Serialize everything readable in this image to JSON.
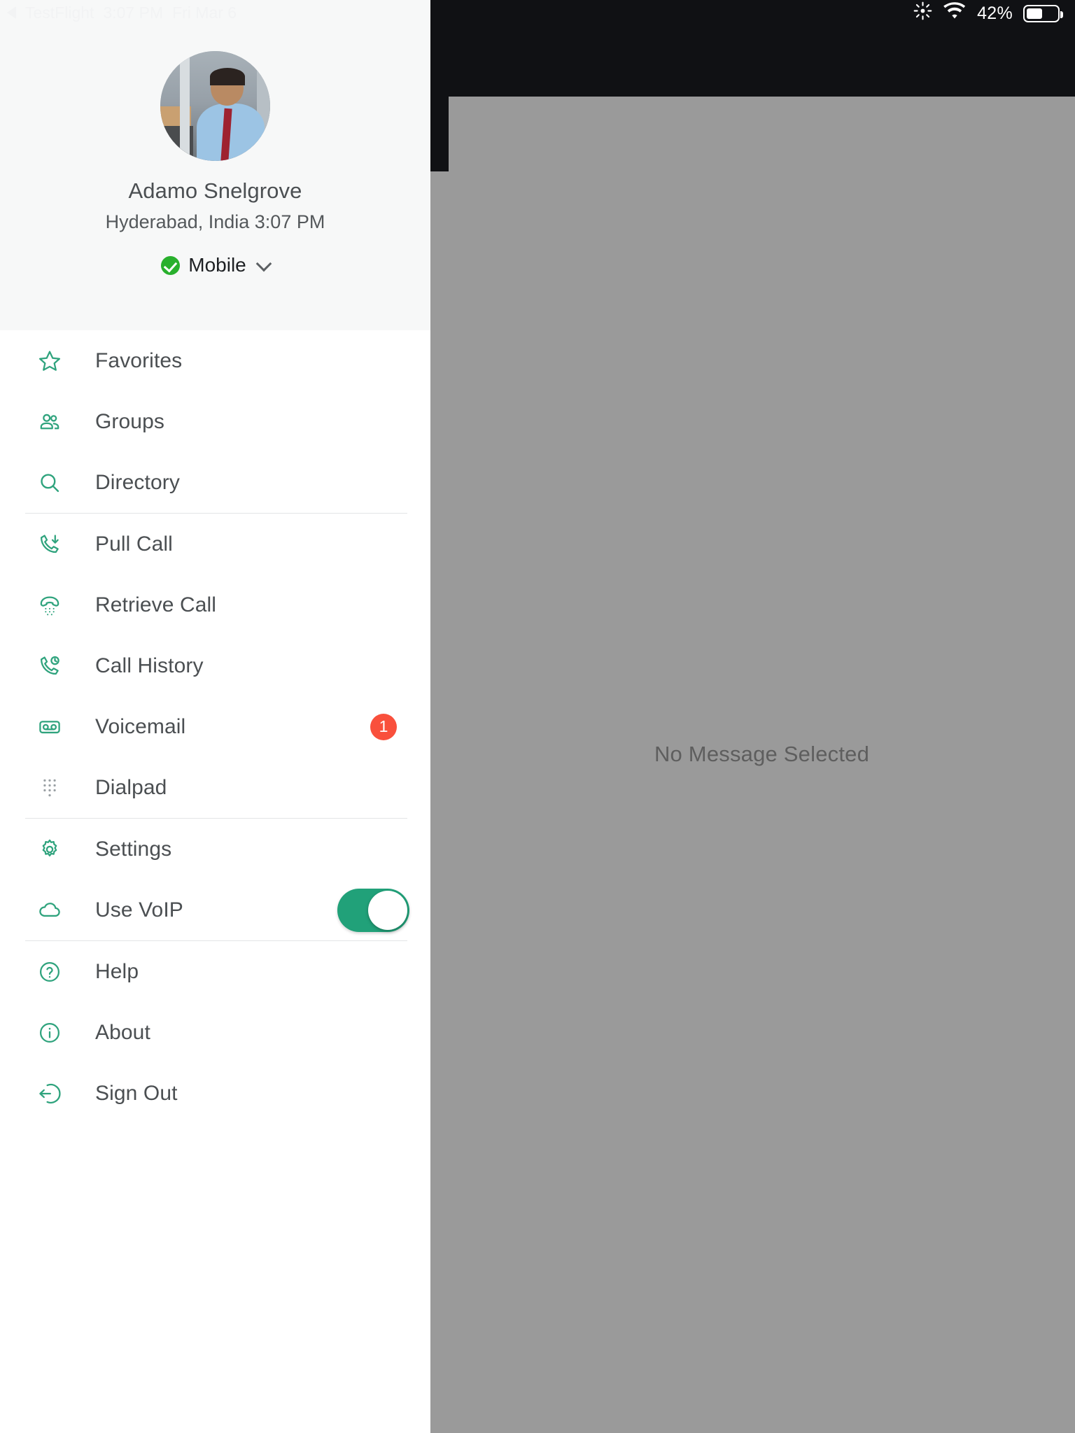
{
  "statusbar": {
    "back_app": "TestFlight",
    "time": "3:07 PM",
    "date": "Fri Mar 6",
    "brightness_icon": "brightness-icon",
    "wifi_icon": "wifi-icon",
    "battery_percent": "42%",
    "battery_icon": "battery-icon"
  },
  "profile": {
    "avatar_icon": "avatar-photo",
    "name": "Adamo Snelgrove",
    "location_time": "Hyderabad, India 3:07 PM",
    "presence_status": "Mobile",
    "presence_icon": "check-circle-icon",
    "chevron_icon": "chevron-down-icon"
  },
  "menu": {
    "items": [
      {
        "id": "favorites",
        "label": "Favorites",
        "icon": "star-icon"
      },
      {
        "id": "groups",
        "label": "Groups",
        "icon": "people-icon"
      },
      {
        "id": "directory",
        "label": "Directory",
        "icon": "search-icon"
      },
      {
        "id": "pull-call",
        "label": "Pull Call",
        "icon": "phone-down-arrow-icon"
      },
      {
        "id": "retrieve-call",
        "label": "Retrieve Call",
        "icon": "ringing-handset-icon"
      },
      {
        "id": "call-history",
        "label": "Call History",
        "icon": "phone-clock-icon"
      },
      {
        "id": "voicemail",
        "label": "Voicemail",
        "icon": "voicemail-icon",
        "badge": "1"
      },
      {
        "id": "dialpad",
        "label": "Dialpad",
        "icon": "dialpad-icon"
      },
      {
        "id": "settings",
        "label": "Settings",
        "icon": "gear-icon"
      },
      {
        "id": "use-voip",
        "label": "Use VoIP",
        "icon": "cloud-icon",
        "toggle": "on"
      },
      {
        "id": "help",
        "label": "Help",
        "icon": "question-circle-icon"
      },
      {
        "id": "about",
        "label": "About",
        "icon": "info-circle-icon"
      },
      {
        "id": "sign-out",
        "label": "Sign Out",
        "icon": "sign-out-icon"
      }
    ]
  },
  "detail": {
    "empty_state": "No Message Selected"
  },
  "colors": {
    "accent_green": "#2fa37d",
    "toggle_on": "#21a179",
    "badge_red": "#f9503c",
    "presence_green": "#29b02d",
    "panel_gray": "#9a9a9a",
    "dark": "#101114"
  }
}
